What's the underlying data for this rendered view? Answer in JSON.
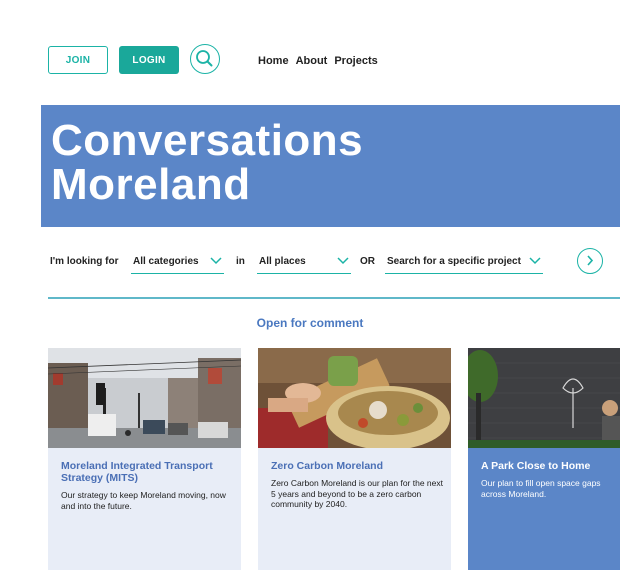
{
  "header": {
    "join_label": "JOIN",
    "login_label": "LOGIN",
    "nav": [
      "Home",
      "About",
      "Projects"
    ]
  },
  "hero": {
    "title_line1": "Conversations",
    "title_line2": "Moreland"
  },
  "filters": {
    "looking_for_label": "I'm looking for",
    "category_value": "All categories",
    "in_label": "in",
    "place_value": "All places",
    "or_label": "OR",
    "project_placeholder": "Search for a specific project"
  },
  "section": {
    "title": "Open for comment"
  },
  "cards": [
    {
      "title": "Moreland Integrated Transport Strategy (MITS)",
      "description": "Our strategy to keep Moreland moving, now and into the future."
    },
    {
      "title": "Zero Carbon Moreland",
      "description": "Zero Carbon Moreland is our plan for the next 5 years and beyond to be a zero carbon community by 2040."
    },
    {
      "title": "A Park Close to Home",
      "description": "Our plan to fill open space gaps across Moreland."
    }
  ],
  "colors": {
    "accent_teal": "#1bb3a6",
    "hero_blue": "#5b86c8",
    "card_bg": "#e8edf7"
  },
  "icons": [
    "search-icon",
    "chevron-down-icon",
    "chevron-right-icon"
  ]
}
